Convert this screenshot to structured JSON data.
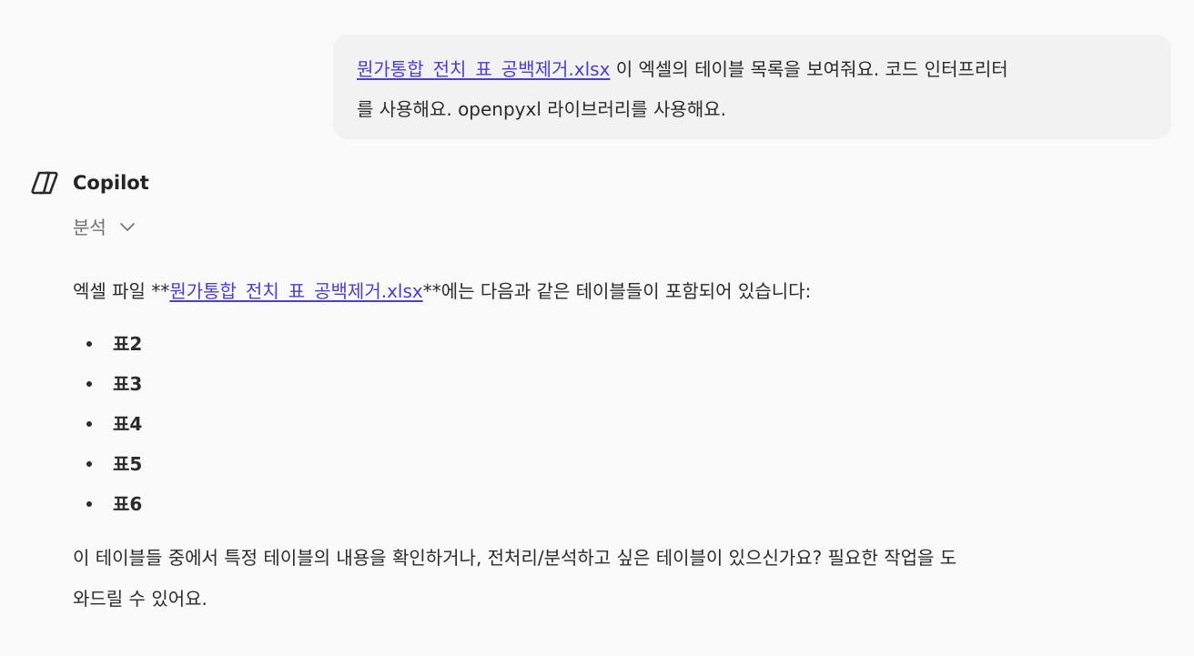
{
  "user_message": {
    "file_link": "뭔가통합_전치_표_공백제거.xlsx",
    "line1_after_link": " 이 엑셀의 테이블 목록을 보여줘요. 코드 인터프리터",
    "line2": "를 사용해요. openpyxl 라이브러리를 사용해요."
  },
  "assistant": {
    "name": "Copilot",
    "logo_icon": "copilot-logo-icon",
    "analysis_label": "분석",
    "intro_prefix": "엑셀 파일 **",
    "intro_file_link": "뭔가통합_전치_표_공백제거.xlsx",
    "intro_suffix": "**에는 다음과 같은 테이블들이 포함되어 있습니다:",
    "tables": [
      "표2",
      "표3",
      "표4",
      "표5",
      "표6"
    ],
    "outro_line1": "이 테이블들 중에서 특정 테이블의 내용을 확인하거나, 전처리/분석하고 싶은 테이블이 있으신가요? 필요한 작업을 도",
    "outro_line2": "와드릴 수 있어요."
  },
  "colors": {
    "background": "#fafafa",
    "user_bubble": "#f2f2f2",
    "link": "#4a3fcf",
    "text": "#2b2b2b",
    "muted": "#707070"
  }
}
